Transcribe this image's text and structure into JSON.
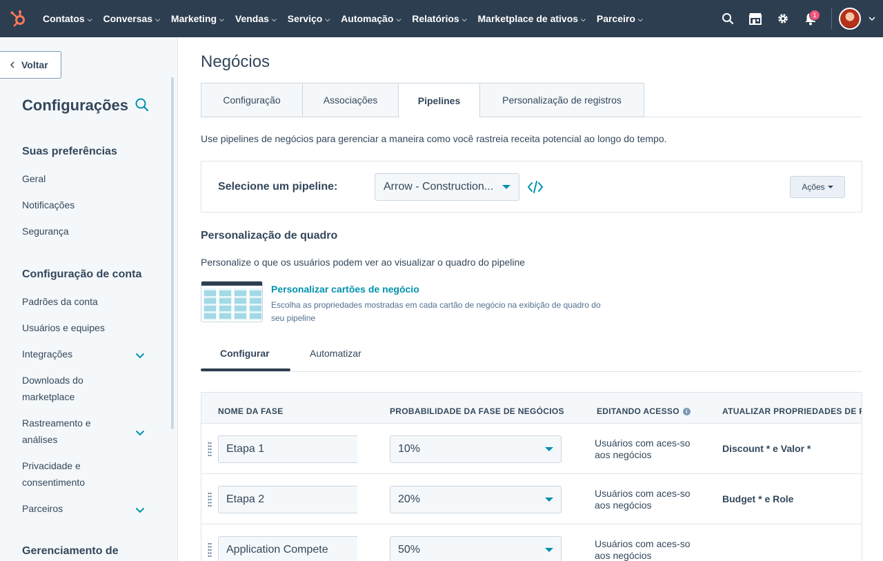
{
  "nav": {
    "items": [
      "Contatos",
      "Conversas",
      "Marketing",
      "Vendas",
      "Serviço",
      "Automação",
      "Relatórios",
      "Marketplace de ativos",
      "Parceiro"
    ],
    "notification_count": "1",
    "icons": [
      "hubspot-logo-icon",
      "search-icon",
      "marketplace-icon",
      "gear-icon",
      "bell-icon"
    ]
  },
  "sidebar": {
    "back_label": "Voltar",
    "title": "Configurações",
    "sections": [
      {
        "title": "Suas preferências",
        "items": [
          "Geral",
          "Notificações",
          "Segurança"
        ]
      },
      {
        "title": "Configuração de conta",
        "items": [
          "Padrões da conta",
          "Usuários e equipes",
          "Integrações",
          "Downloads do marketplace",
          "Rastreamento e análises",
          "Privacidade e consentimento",
          "Parceiros"
        ]
      },
      {
        "title": "Gerenciamento de"
      }
    ]
  },
  "main": {
    "title": "Negócios",
    "tabs": [
      "Configuração",
      "Associações",
      "Pipelines",
      "Personalização de registros"
    ],
    "active_tab": "Pipelines",
    "description": "Use pipelines de negócios para gerenciar a maneira como você rastreia receita potencial ao longo do tempo.",
    "pipeline": {
      "label": "Selecione um pipeline:",
      "selected": "Arrow - Construction...",
      "actions_label": "Ações"
    },
    "board": {
      "title": "Personalização de quadro",
      "description": "Personalize o que os usuários podem ver ao visualizar o quadro do pipeline",
      "link": "Personalizar cartões de negócio",
      "link_desc": "Escolha as propriedades mostradas em cada cartão de negócio na exibição de quadro do seu pipeline"
    },
    "subtabs": [
      "Configurar",
      "Automatizar"
    ],
    "table": {
      "headers": [
        "NOME DA FASE",
        "PROBABILIDADE DA FASE DE NEGÓCIOS",
        "EDITANDO ACESSO",
        "ATUALIZAR PROPRIEDADES DE F"
      ],
      "rows": [
        {
          "stage": "Etapa 1",
          "probability": "10%",
          "access": "Usuários com aces-so aos negócios",
          "props": "Discount * e Valor *"
        },
        {
          "stage": "Etapa 2",
          "probability": "20%",
          "access": "Usuários com aces-so aos negócios",
          "props": "Budget * e Role"
        },
        {
          "stage": "Application Compete",
          "probability": "50%",
          "access": "Usuários com aces-so aos negócios",
          "props": ""
        }
      ]
    }
  },
  "colors": {
    "nav_bg": "#2d3e50",
    "accent": "#0091ae",
    "logo": "#ff7a59",
    "badge": "#f2547d"
  }
}
